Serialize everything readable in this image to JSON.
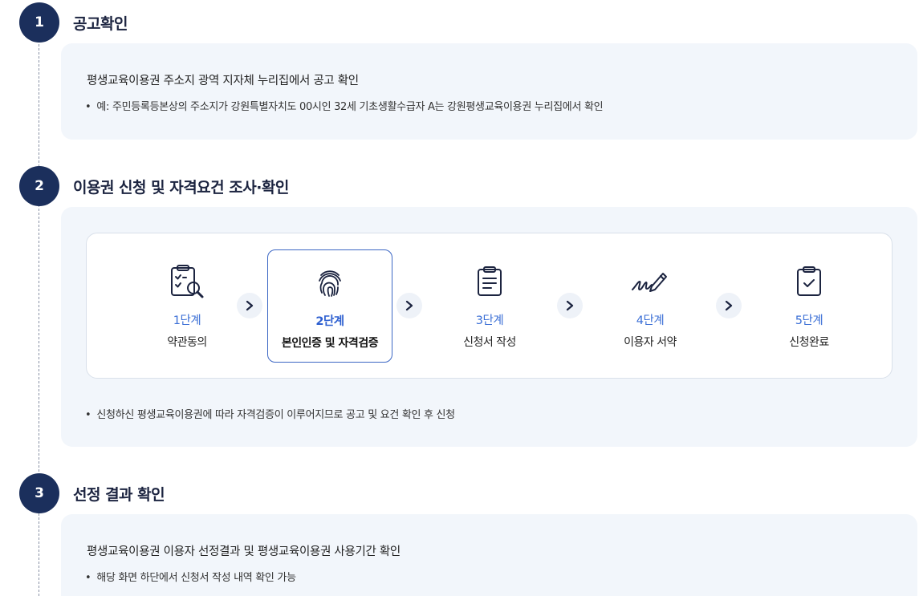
{
  "colors": {
    "accent": "#1b2f5c",
    "step_blue": "#3b6fd6",
    "panel_bg": "#f2f6fb"
  },
  "sections": [
    {
      "number": "1",
      "title": "공고확인",
      "main_text": "평생교육이용권 주소지 광역 지자체 누리집에서 공고 확인",
      "bullet": "예: 주민등록등본상의 주소지가 강원특별자치도 00시인 32세 기초생활수급자 A는 강원평생교육이용권 누리집에서 확인"
    },
    {
      "number": "2",
      "title": "이용권 신청 및 자격요건 조사·확인",
      "steps": [
        {
          "num": "1단계",
          "label": "약관동의",
          "icon": "clipboard-search-icon"
        },
        {
          "num": "2단계",
          "label": "본인인증 및 자격검증",
          "icon": "fingerprint-icon"
        },
        {
          "num": "3단계",
          "label": "신청서 작성",
          "icon": "document-icon"
        },
        {
          "num": "4단계",
          "label": "이용자 서약",
          "icon": "signature-pen-icon"
        },
        {
          "num": "5단계",
          "label": "신청완료",
          "icon": "clipboard-check-icon"
        }
      ],
      "active_step": 2,
      "bullet": "신청하신 평생교육이용권에 따라 자격검증이 이루어지므로 공고 및 요건 확인 후 신청"
    },
    {
      "number": "3",
      "title": "선정 결과 확인",
      "main_text": "평생교육이용권 이용자 선정결과 및 평생교육이용권 사용기간 확인",
      "bullet": "해당 화면 하단에서 신청서 작성 내역 확인 가능"
    }
  ],
  "bullet_mark": "•",
  "arrow_glyph": "›"
}
